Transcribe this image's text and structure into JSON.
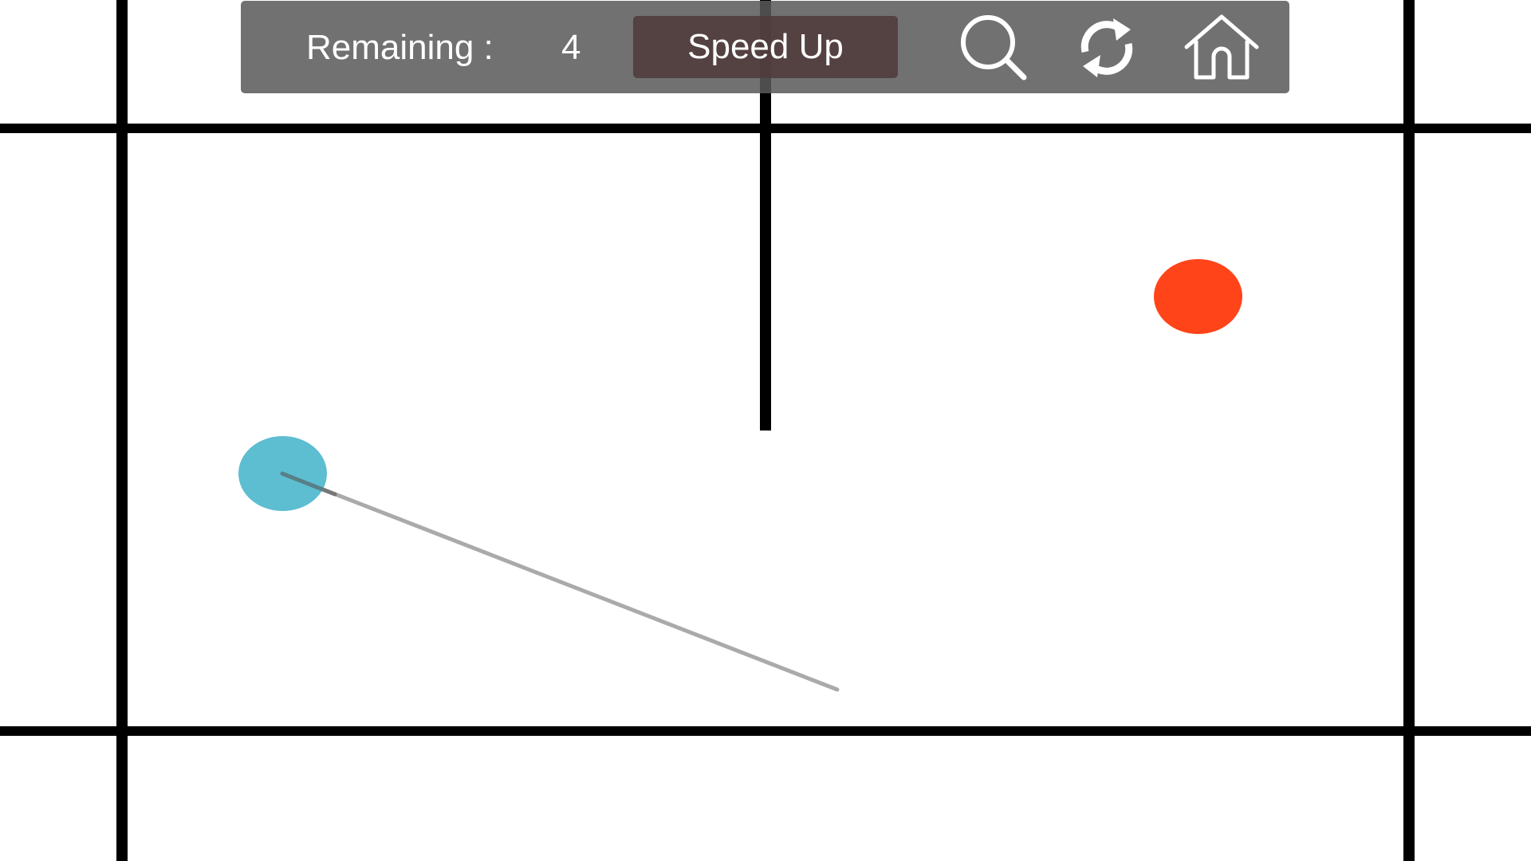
{
  "hud": {
    "remaining_label": "Remaining :",
    "remaining_value": "4",
    "speed_up_label": "Speed Up",
    "icons": [
      "search-icon",
      "restart-icon",
      "home-icon"
    ]
  },
  "colors": {
    "player_ball": "#5dbdd1",
    "target_ball": "#ff4419",
    "walls": "#000000",
    "aim_line": "#aaaaaa",
    "hud_background": "#5a5a5a",
    "speed_up_background": "#503a3a"
  }
}
